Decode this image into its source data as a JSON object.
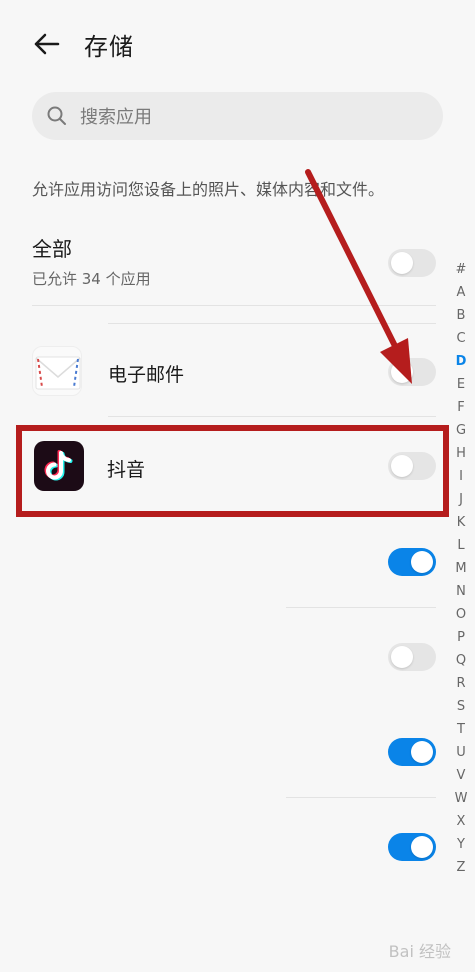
{
  "header": {
    "title": "存储",
    "back_icon": "arrow-left-icon"
  },
  "search": {
    "placeholder": "搜索应用",
    "icon": "search-icon"
  },
  "description": "允许应用访问您设备上的照片、媒体内容和文件。",
  "all": {
    "title": "全部",
    "subtitle": "已允许 34 个应用",
    "enabled": false
  },
  "apps": [
    {
      "name": "电子邮件",
      "icon": "email-envelope-icon",
      "enabled": false
    },
    {
      "name": "抖音",
      "icon": "tiktok-icon",
      "enabled": false
    }
  ],
  "hidden_rows": [
    {
      "enabled": true
    },
    {
      "enabled": false
    },
    {
      "enabled": true
    },
    {
      "enabled": true
    }
  ],
  "index_bar": {
    "letters": [
      "#",
      "A",
      "B",
      "C",
      "D",
      "E",
      "F",
      "G",
      "H",
      "I",
      "J",
      "K",
      "L",
      "M",
      "N",
      "O",
      "P",
      "Q",
      "R",
      "S",
      "T",
      "U",
      "V",
      "W",
      "X",
      "Y",
      "Z"
    ],
    "active": "D"
  },
  "colors": {
    "accent": "#0a84e8",
    "annotation": "#b51d1d",
    "toggle_off": "#e5e5e5"
  },
  "watermark": "Bai 经验"
}
